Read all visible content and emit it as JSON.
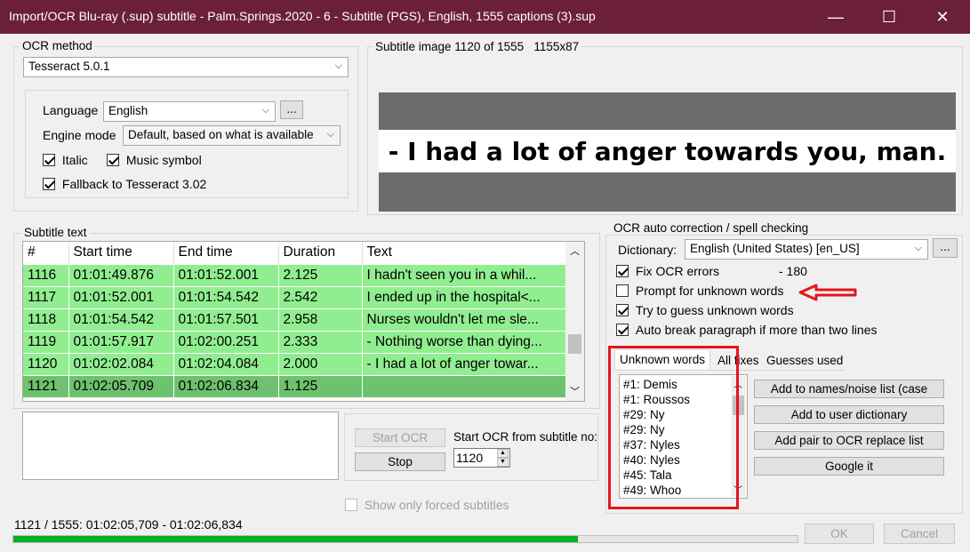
{
  "window": {
    "title": "Import/OCR Blu-ray (.sup) subtitle - Palm.Springs.2020 - 6 - Subtitle (PGS), English, 1555 captions (3).sup",
    "minimize": "—",
    "maximize": "☐",
    "close": "✕"
  },
  "ocr_method": {
    "label": "OCR method",
    "selected": "Tesseract 5.0.1",
    "language_label": "Language",
    "language_value": "English",
    "language_more": "...",
    "engine_label": "Engine mode",
    "engine_value": "Default, based on what is available",
    "italic_label": "Italic",
    "music_label": "Music symbol",
    "fallback_label": "Fallback to Tesseract 3.02"
  },
  "subtitle_image": {
    "label": "Subtitle image 1120 of 1555   1155x87",
    "text": "- I had a lot of anger towards you, man."
  },
  "subtitle_text": {
    "label": "Subtitle text",
    "columns": [
      "#",
      "Start time",
      "End time",
      "Duration",
      "Text"
    ],
    "rows": [
      {
        "num": "1116",
        "start": "01:01:49.876",
        "end": "01:01:52.001",
        "dur": "2.125",
        "text": "I hadn't seen you in a whil..."
      },
      {
        "num": "1117",
        "start": "01:01:52.001",
        "end": "01:01:54.542",
        "dur": "2.542",
        "text": "I ended up in the hospital<..."
      },
      {
        "num": "1118",
        "start": "01:01:54.542",
        "end": "01:01:57.501",
        "dur": "2.958",
        "text": "Nurses wouldn't let me sle..."
      },
      {
        "num": "1119",
        "start": "01:01:57.917",
        "end": "01:02:00.251",
        "dur": "2.333",
        "text": "- Nothing worse than dying..."
      },
      {
        "num": "1120",
        "start": "01:02:02.084",
        "end": "01:02:04.084",
        "dur": "2.000",
        "text": "- I had a lot of anger towar..."
      },
      {
        "num": "1121",
        "start": "01:02:05.709",
        "end": "01:02:06.834",
        "dur": "1.125",
        "text": ""
      }
    ]
  },
  "controls": {
    "start_ocr": "Start OCR",
    "stop": "Stop",
    "start_from_label": "Start OCR from subtitle no:",
    "start_from_value": "1120",
    "show_forced": "Show only forced subtitles"
  },
  "autocorrect": {
    "label": "OCR auto correction / spell checking",
    "dictionary_label": "Dictionary:",
    "dictionary_value": "English (United States) [en_US]",
    "dictionary_more": "...",
    "fix_ocr": "Fix OCR errors",
    "fix_ocr_count": "- 180",
    "prompt_unknown": "Prompt for unknown words",
    "try_guess": "Try to guess unknown words",
    "auto_break": "Auto break paragraph if more than two lines"
  },
  "tabs": [
    "Unknown words",
    "All fixes",
    "Guesses used"
  ],
  "unknown_words": [
    "#1: Demis",
    "#1: Roussos",
    "#29: Ny",
    "#29: Ny",
    "#37: Nyles",
    "#40: Nyles",
    "#45: Tala",
    "#49: Whoo"
  ],
  "word_actions": {
    "add_names": "Add to names/noise list (case",
    "add_user_dict": "Add to user dictionary",
    "add_pair": "Add pair to OCR replace list",
    "google": "Google it"
  },
  "status": {
    "text": "1121 / 1555: 01:02:05,709 - 01:02:06,834",
    "progress": 0.72,
    "ok": "OK",
    "cancel": "Cancel"
  },
  "colors": {
    "title_bar": "#6b1f3a",
    "row_green": "#90ee90",
    "row_selected": "#6ec16e",
    "annotation_red": "#e2161e",
    "progress_green": "#06b025"
  }
}
